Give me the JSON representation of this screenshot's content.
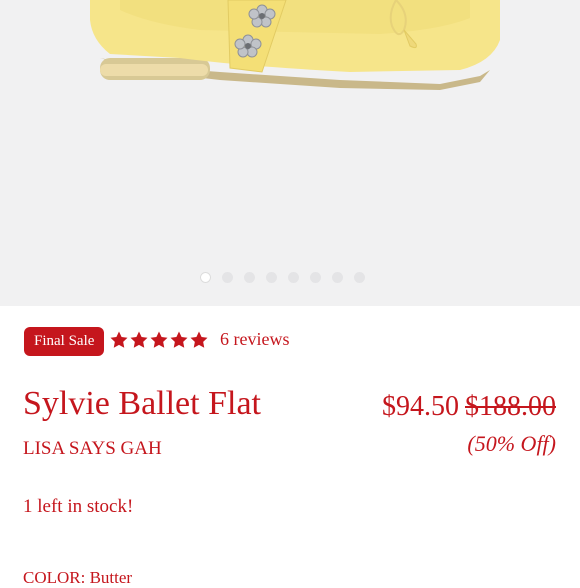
{
  "product": {
    "badge": "Final Sale",
    "rating_stars": 5,
    "reviews_text": "6 reviews",
    "title": "Sylvie Ballet Flat",
    "brand": "LISA SAYS GAH",
    "sale_price": "$94.50",
    "original_price": "$188.00",
    "discount": "(50% Off)",
    "stock_text": "1 left in stock!",
    "color_label": "COLOR: Butter"
  },
  "gallery": {
    "image_count": 8,
    "active_index": 0
  },
  "colors": {
    "accent": "#c5161d",
    "gallery_bg": "#f1f1f2",
    "shoe": "#f6e58a"
  },
  "icons": {
    "star": "star-icon"
  }
}
